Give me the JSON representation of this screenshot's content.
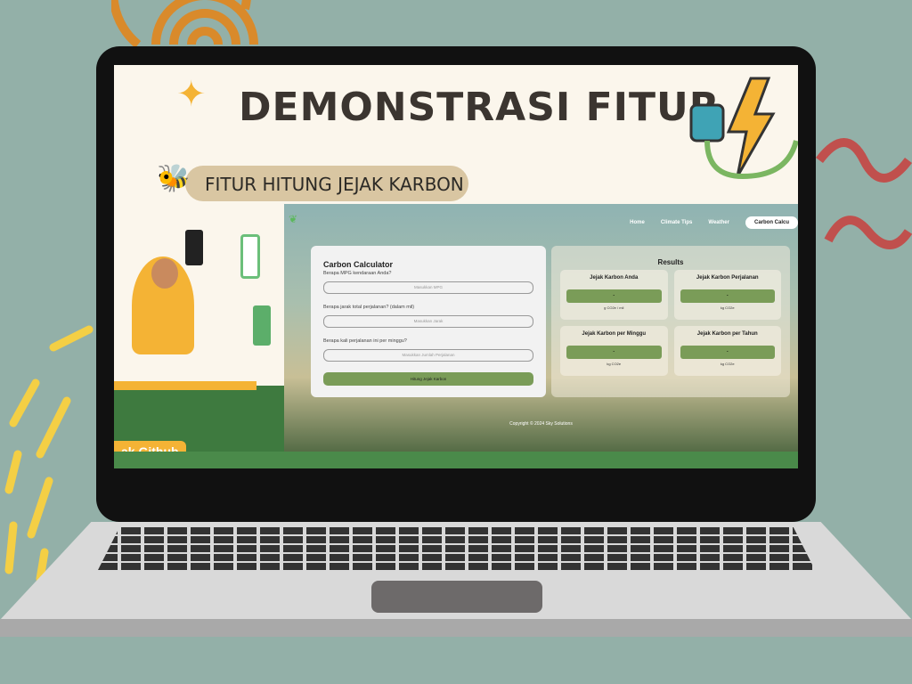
{
  "slide": {
    "title": "DEMONSTRASI FITUR",
    "subtitle": "FITUR HITUNG JEJAK KARBON",
    "github_label": "ak Github"
  },
  "nav": {
    "items": [
      "Home",
      "Climate Tips",
      "Weather",
      "Carbon Calcu"
    ]
  },
  "calculator": {
    "title": "Carbon Calculator",
    "fields": [
      {
        "label": "Berapa MPG kendaraan Anda?",
        "placeholder": "Masukkan MPG"
      },
      {
        "label": "Berapa jarak total perjalanan? (dalam mil)",
        "placeholder": "Masukkan Jarak"
      },
      {
        "label": "Berapa kali perjalanan ini per minggu?",
        "placeholder": "Masukkan Jumlah Perjalanan"
      }
    ],
    "button": "Hitung Jejak Karbon"
  },
  "results": {
    "title": "Results",
    "cards": [
      {
        "title": "Jejak Karbon Anda",
        "value": "-",
        "unit": "g CO2e / mil"
      },
      {
        "title": "Jejak Karbon Perjalanan",
        "value": "-",
        "unit": "kg CO2e"
      },
      {
        "title": "Jejak Karbon per Minggu",
        "value": "-",
        "unit": "kg CO2e"
      },
      {
        "title": "Jejak Karbon per Tahun",
        "value": "-",
        "unit": "kg CO2e"
      }
    ]
  },
  "footer": "Copyright © 2024 Sky Solutions",
  "colors": {
    "background": "#93b0a8",
    "accent": "#7a9c58"
  }
}
